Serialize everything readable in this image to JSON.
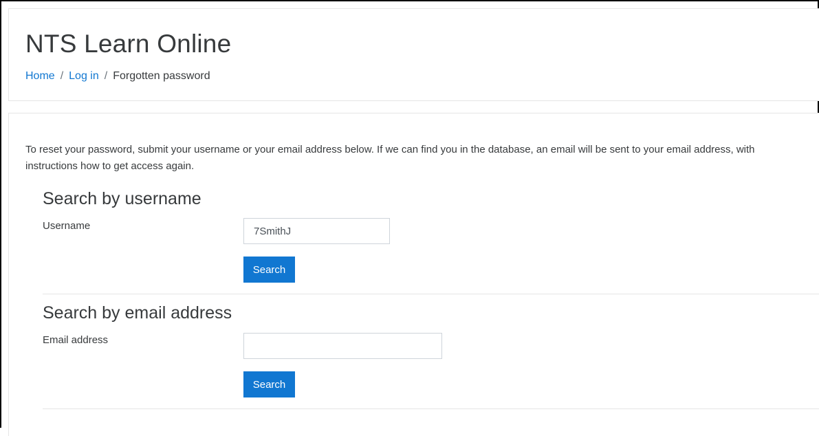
{
  "header": {
    "site_title": "NTS Learn Online",
    "breadcrumb": {
      "home": "Home",
      "separator": "/",
      "login": "Log in",
      "current": "Forgotten password"
    }
  },
  "main": {
    "intro": "To reset your password, submit your username or your email address below. If we can find you in the database, an email will be sent to your email address, with instructions how to get access again.",
    "username_section": {
      "title": "Search by username",
      "label": "Username",
      "value": "7SmithJ",
      "button": "Search"
    },
    "email_section": {
      "title": "Search by email address",
      "label": "Email address",
      "value": "",
      "button": "Search"
    }
  },
  "colors": {
    "accent": "#1177d1",
    "text": "#373a3c",
    "border": "#e5e5e5"
  }
}
